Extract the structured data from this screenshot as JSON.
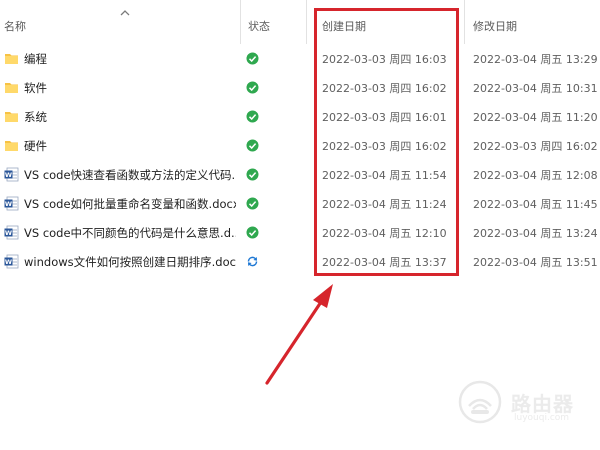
{
  "columns": {
    "name": "名称",
    "status": "状态",
    "created": "创建日期",
    "modified": "修改日期"
  },
  "files": [
    {
      "type": "folder",
      "name": "编程",
      "status": "synced",
      "created": "2022-03-03 周四 16:03",
      "modified": "2022-03-04 周五 13:29"
    },
    {
      "type": "folder",
      "name": "软件",
      "status": "synced",
      "created": "2022-03-03 周四 16:02",
      "modified": "2022-03-04 周五 10:31"
    },
    {
      "type": "folder",
      "name": "系统",
      "status": "synced",
      "created": "2022-03-03 周四 16:01",
      "modified": "2022-03-04 周五 11:20"
    },
    {
      "type": "folder",
      "name": "硬件",
      "status": "synced",
      "created": "2022-03-03 周四 16:02",
      "modified": "2022-03-03 周四 16:02"
    },
    {
      "type": "docx",
      "name": "VS code快速查看函数或方法的定义代码...",
      "status": "synced",
      "created": "2022-03-04 周五 11:54",
      "modified": "2022-03-04 周五 12:08"
    },
    {
      "type": "docx",
      "name": "VS code如何批量重命名变量和函数.docx",
      "status": "synced",
      "created": "2022-03-04 周五 11:24",
      "modified": "2022-03-04 周五 11:45"
    },
    {
      "type": "docx",
      "name": "VS code中不同颜色的代码是什么意思.d...",
      "status": "synced",
      "created": "2022-03-04 周五 12:10",
      "modified": "2022-03-04 周五 13:24"
    },
    {
      "type": "docx",
      "name": "windows文件如何按照创建日期排序.docx",
      "status": "syncing",
      "created": "2022-03-04 周五 13:37",
      "modified": "2022-03-04 周五 13:51"
    }
  ],
  "colors": {
    "folder": "#f7c244",
    "synced": "#2fa84f",
    "syncing": "#1e78d4",
    "highlight": "#d6252c",
    "word": "#2b579a"
  },
  "watermark": {
    "title": "路由器",
    "subtitle": "luyouqi.com"
  }
}
